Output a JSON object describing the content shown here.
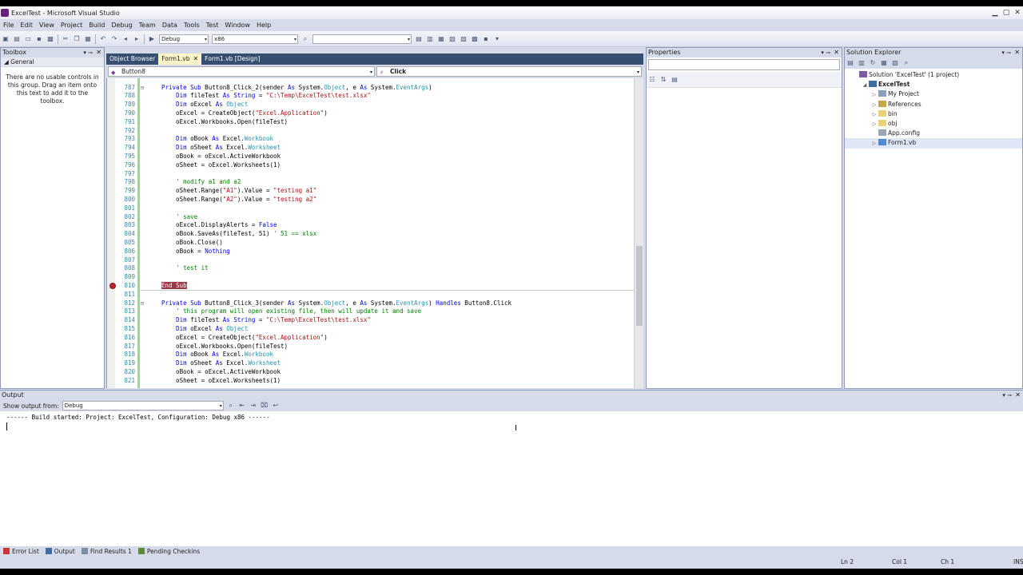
{
  "window": {
    "title": "ExcelTest - Microsoft Visual Studio"
  },
  "menu": [
    "File",
    "Edit",
    "View",
    "Project",
    "Build",
    "Debug",
    "Team",
    "Data",
    "Tools",
    "Test",
    "Window",
    "Help"
  ],
  "toolbar": {
    "config": "Debug",
    "platform": "x86"
  },
  "toolbox": {
    "title": "Toolbox",
    "group": "General",
    "message": "There are no usable controls in this group. Drag an item onto this text to add it to the toolbox."
  },
  "editor": {
    "tabs": [
      {
        "label": "Object Browser"
      },
      {
        "label": "Form1.vb"
      },
      {
        "label": "Form1.vb [Design]"
      }
    ],
    "left_combo": "Button8",
    "right_combo": "Click"
  },
  "code_lines": [
    {
      "n": "787",
      "t": "Private Sub Button8_Click_2(sender As System.Object, e As System.EventArgs)"
    },
    {
      "n": "788",
      "t": "    Dim fileTest As String = \"C:\\Temp\\ExcelTest\\test.xlsx\""
    },
    {
      "n": "789",
      "t": "    Dim oExcel As Object"
    },
    {
      "n": "790",
      "t": "    oExcel = CreateObject(\"Excel.Application\")"
    },
    {
      "n": "791",
      "t": "    oExcel.Workbooks.Open(fileTest)"
    },
    {
      "n": "792",
      "t": ""
    },
    {
      "n": "793",
      "t": "    Dim oBook As Excel.Workbook"
    },
    {
      "n": "794",
      "t": "    Dim oSheet As Excel.Worksheet"
    },
    {
      "n": "795",
      "t": "    oBook = oExcel.ActiveWorkbook"
    },
    {
      "n": "796",
      "t": "    oSheet = oExcel.Worksheets(1)"
    },
    {
      "n": "797",
      "t": ""
    },
    {
      "n": "798",
      "t": "    ' modify a1 and a2"
    },
    {
      "n": "799",
      "t": "    oSheet.Range(\"A1\").Value = \"testing a1\""
    },
    {
      "n": "800",
      "t": "    oSheet.Range(\"A2\").Value = \"testing a2\""
    },
    {
      "n": "801",
      "t": ""
    },
    {
      "n": "802",
      "t": "    ' save"
    },
    {
      "n": "803",
      "t": "    oExcel.DisplayAlerts = False"
    },
    {
      "n": "804",
      "t": "    oBook.SaveAs(fileTest, 51) ' 51 == xlsx"
    },
    {
      "n": "805",
      "t": "    oBook.Close()"
    },
    {
      "n": "806",
      "t": "    oBook = Nothing"
    },
    {
      "n": "807",
      "t": ""
    },
    {
      "n": "808",
      "t": "    ' test it"
    },
    {
      "n": "809",
      "t": ""
    },
    {
      "n": "810",
      "t": "End Sub"
    },
    {
      "n": "811",
      "t": ""
    },
    {
      "n": "812",
      "t": "Private Sub Button8_Click_3(sender As System.Object, e As System.EventArgs) Handles Button8.Click"
    },
    {
      "n": "813",
      "t": "    ' this program will open existing file, then will update it and save"
    },
    {
      "n": "814",
      "t": "    Dim fileTest As String = \"C:\\Temp\\ExcelTest\\test.xlsx\""
    },
    {
      "n": "815",
      "t": "    Dim oExcel As Object"
    },
    {
      "n": "816",
      "t": "    oExcel = CreateObject(\"Excel.Application\")"
    },
    {
      "n": "817",
      "t": "    oExcel.Workbooks.Open(fileTest)"
    },
    {
      "n": "818",
      "t": "    Dim oBook As Excel.Workbook"
    },
    {
      "n": "819",
      "t": "    Dim oSheet As Excel.Worksheet"
    },
    {
      "n": "820",
      "t": "    oBook = oExcel.ActiveWorkbook"
    },
    {
      "n": "821",
      "t": "    oSheet = oExcel.Worksheets(1)"
    }
  ],
  "properties": {
    "title": "Properties"
  },
  "solution_explorer": {
    "title": "Solution Explorer",
    "items": [
      {
        "label": "Solution 'ExcelTest' (1 project)",
        "depth": 0,
        "exp": "",
        "bold": false
      },
      {
        "label": "ExcelTest",
        "depth": 1,
        "exp": "◢",
        "bold": true
      },
      {
        "label": "My Project",
        "depth": 2,
        "exp": "▷",
        "bold": false
      },
      {
        "label": "References",
        "depth": 2,
        "exp": "▷",
        "bold": false
      },
      {
        "label": "bin",
        "depth": 2,
        "exp": "▷",
        "bold": false
      },
      {
        "label": "obj",
        "depth": 2,
        "exp": "▷",
        "bold": false
      },
      {
        "label": "App.config",
        "depth": 2,
        "exp": "",
        "bold": false
      },
      {
        "label": "Form1.vb",
        "depth": 2,
        "exp": "▷",
        "bold": false
      }
    ]
  },
  "output": {
    "title": "Output",
    "show_from_label": "Show output from:",
    "show_from_value": "Debug",
    "text": "------ Build started: Project: ExcelTest, Configuration: Debug x86 ------"
  },
  "bottom_tabs": [
    "Error List",
    "Output",
    "Find Results 1",
    "Pending Checkins"
  ],
  "status": {
    "ln": "Ln 2",
    "col": "Col 1",
    "ch": "Ch 1",
    "ins": "INS"
  },
  "colors": {
    "panel_header": "#364e6f",
    "active_tab": "#fff4c8",
    "breakpoint": "#c41f30"
  }
}
